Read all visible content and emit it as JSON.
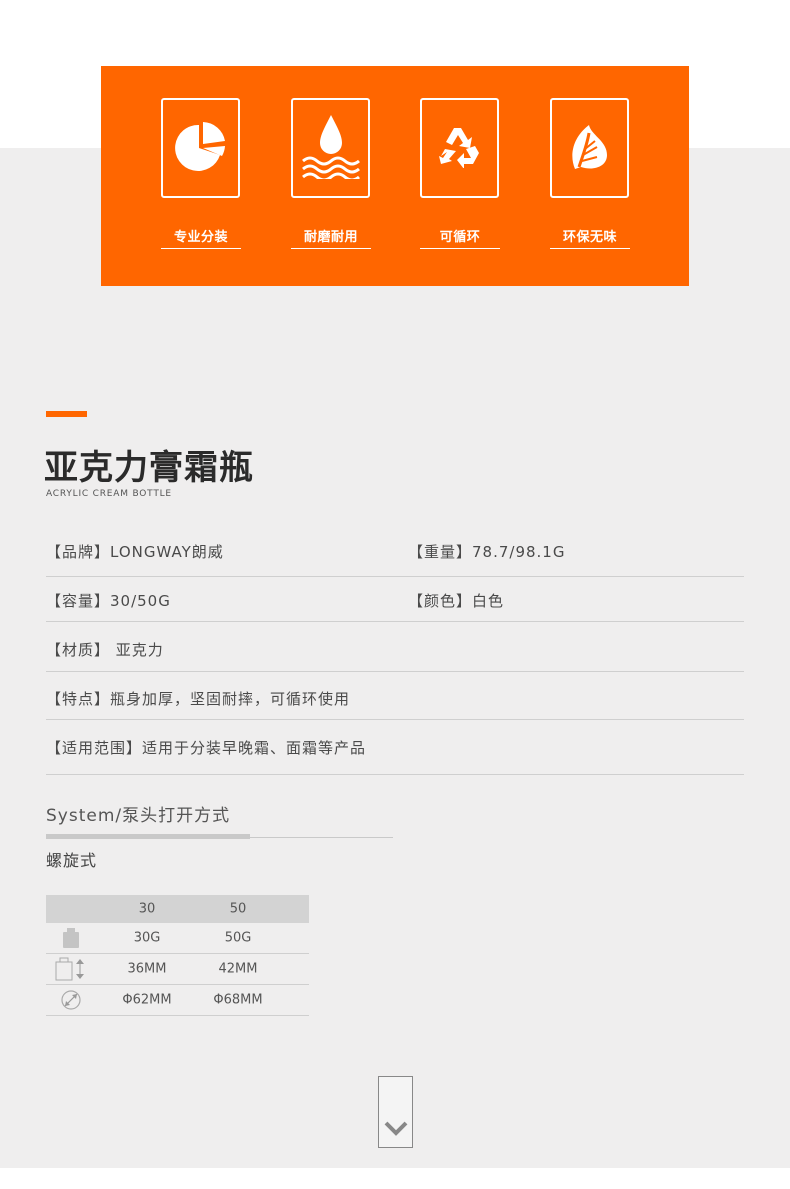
{
  "features": [
    {
      "icon": "pie-chart-icon",
      "label": "专业分装"
    },
    {
      "icon": "water-drop-icon",
      "label": "耐磨耐用"
    },
    {
      "icon": "recycle-icon",
      "label": "可循环"
    },
    {
      "icon": "leaf-icon",
      "label": "环保无味"
    }
  ],
  "product": {
    "title": "亚克力膏霜瓶",
    "subtitle": "ACRYLIC CREAM BOTTLE"
  },
  "specs": {
    "brand": "【品牌】LONGWAY朗威",
    "weight": "【重量】78.7/98.1G",
    "capacity": "【容量】30/50G",
    "color": "【颜色】白色",
    "material": "【材质】 亚克力",
    "features": "【特点】瓶身加厚，坚固耐摔，可循环使用",
    "scope": "【适用范围】适用于分装早晚霜、面霜等产品"
  },
  "system": {
    "title": "System/泵头打开方式",
    "type": "螺旋式"
  },
  "table": {
    "headers": [
      "30",
      "50"
    ],
    "rows": [
      {
        "icon": "bottle-weight-icon",
        "values": [
          "30G",
          "50G"
        ]
      },
      {
        "icon": "bottle-height-icon",
        "values": [
          "36MM",
          "42MM"
        ]
      },
      {
        "icon": "diameter-icon",
        "values": [
          "Φ62MM",
          "Φ68MM"
        ]
      }
    ]
  },
  "colors": {
    "accent": "#ff6600",
    "background": "#efeeee"
  }
}
